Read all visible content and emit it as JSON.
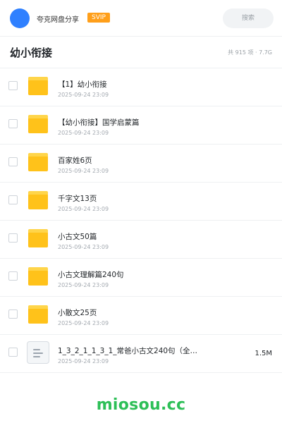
{
  "header": {
    "account_name": "夸克网盘分享",
    "badge": "SVIP",
    "search_label": "搜索"
  },
  "folder": {
    "title": "幼小衔接",
    "summary": "共 915 项 · 7.7G"
  },
  "files": [
    {
      "name": "【1】幼小衔接",
      "date": "2025-09-24 23:09",
      "type": "folder",
      "icon": "folder-icon"
    },
    {
      "name": "【幼小衔接】国学启蒙篇",
      "date": "2025-09-24 23:09",
      "type": "folder",
      "icon": "folder-icon"
    },
    {
      "name": "百家姓6页",
      "date": "2025-09-24 23:09",
      "type": "folder",
      "icon": "folder-icon"
    },
    {
      "name": "千字文13页",
      "date": "2025-09-24 23:09",
      "type": "folder",
      "icon": "folder-icon"
    },
    {
      "name": "小古文50篇",
      "date": "2025-09-24 23:09",
      "type": "folder",
      "icon": "folder-icon"
    },
    {
      "name": "小古文理解篇240句",
      "date": "2025-09-24 23:09",
      "type": "folder",
      "icon": "folder-icon"
    },
    {
      "name": "小散文25页",
      "date": "2025-09-24 23:09",
      "type": "folder",
      "icon": "folder-icon"
    },
    {
      "name": "1_3_2_1_1_3_1_常爸小古文240句（全…",
      "date": "2025-09-24 23:09",
      "type": "document",
      "size": "1.5M",
      "icon": "document-icon"
    }
  ],
  "watermark": "miosou.cc",
  "colors": {
    "accent": "#2f80ff",
    "badge": "#ff9f1a",
    "folder": "#ffc21a",
    "watermark": "#2dbf57"
  }
}
